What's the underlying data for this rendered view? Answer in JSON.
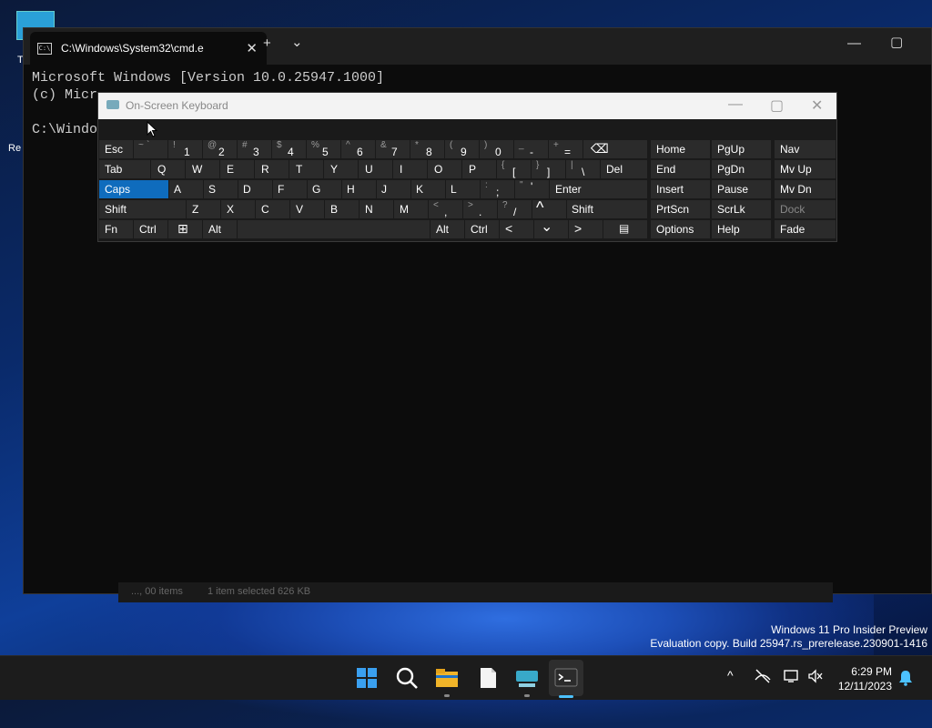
{
  "desktop": {
    "icon_labels": [
      "T",
      "Re"
    ]
  },
  "terminal": {
    "tab_title": "C:\\Windows\\System32\\cmd.e",
    "tab_icon_text": "C:\\",
    "close_glyph": "✕",
    "new_tab_glyph": "+",
    "dropdown_glyph": "⌄",
    "minimize_glyph": "—",
    "maximize_glyph": "▢",
    "lines": [
      "Microsoft Windows [Version 10.0.25947.1000]",
      "(c) Micr",
      "",
      "C:\\Windo"
    ],
    "status_left": "..., 00 items",
    "status_mid": "1 item selected 626 KB"
  },
  "osk": {
    "title": "On-Screen Keyboard",
    "minimize_glyph": "—",
    "maximize_glyph": "▢",
    "close_glyph": "✕",
    "keys": {
      "esc": "Esc",
      "tilde_t": "~",
      "tilde_b": "`",
      "n1_t": "!",
      "n1_b": "1",
      "n2_t": "@",
      "n2_b": "2",
      "n3_t": "#",
      "n3_b": "3",
      "n4_t": "$",
      "n4_b": "4",
      "n5_t": "%",
      "n5_b": "5",
      "n6_t": "^",
      "n6_b": "6",
      "n7_t": "&",
      "n7_b": "7",
      "n8_t": "*",
      "n8_b": "8",
      "n9_t": "(",
      "n9_b": "9",
      "n0_t": ")",
      "n0_b": "0",
      "minus_t": "_",
      "minus_b": "-",
      "plus_t": "+",
      "plus_b": "=",
      "backspace": "⌫",
      "tab": "Tab",
      "q": "Q",
      "w": "W",
      "e": "E",
      "r": "R",
      "t": "T",
      "y": "Y",
      "u": "U",
      "i": "I",
      "o": "O",
      "p": "P",
      "lbr_t": "{",
      "lbr_b": "[",
      "rbr_t": "}",
      "rbr_b": "]",
      "pipe_t": "|",
      "pipe_b": "\\",
      "del": "Del",
      "caps": "Caps",
      "a": "A",
      "s": "S",
      "d": "D",
      "f": "F",
      "g": "G",
      "h": "H",
      "j": "J",
      "k": "K",
      "l": "L",
      "semi_t": ":",
      "semi_b": ";",
      "quote_t": "\"",
      "quote_b": "'",
      "enter": "Enter",
      "shift_l": "Shift",
      "z": "Z",
      "x": "X",
      "c": "C",
      "v": "V",
      "b": "B",
      "n": "N",
      "m": "M",
      "comma_t": "<",
      "comma_b": ",",
      "period_t": ">",
      "period_b": ".",
      "slash_t": "?",
      "slash_b": "/",
      "up": "^",
      "shift_r": "Shift",
      "fn": "Fn",
      "ctrl_l": "Ctrl",
      "win": "⊞",
      "alt_l": "Alt",
      "alt_r": "Alt",
      "ctrl_r": "Ctrl",
      "left": "<",
      "down": "⌄",
      "right": ">",
      "menu": "▤",
      "home": "Home",
      "pgup": "PgUp",
      "nav": "Nav",
      "end": "End",
      "pgdn": "PgDn",
      "mvup": "Mv Up",
      "insert": "Insert",
      "pause": "Pause",
      "mvdn": "Mv Dn",
      "prtscn": "PrtScn",
      "scrlk": "ScrLk",
      "dock": "Dock",
      "options": "Options",
      "help": "Help",
      "fade": "Fade"
    }
  },
  "watermark": {
    "line1": "Windows 11 Pro Insider Preview",
    "line2": "Evaluation copy. Build 25947.rs_prerelease.230901-1416"
  },
  "taskbar": {
    "time": "6:29 PM",
    "date": "12/11/2023",
    "tray_chevron": "^"
  },
  "colors": {
    "caps_active": "#0f6cbd",
    "key_bg": "#2b2b2b",
    "taskbar_bg": "#1c1c1c"
  }
}
